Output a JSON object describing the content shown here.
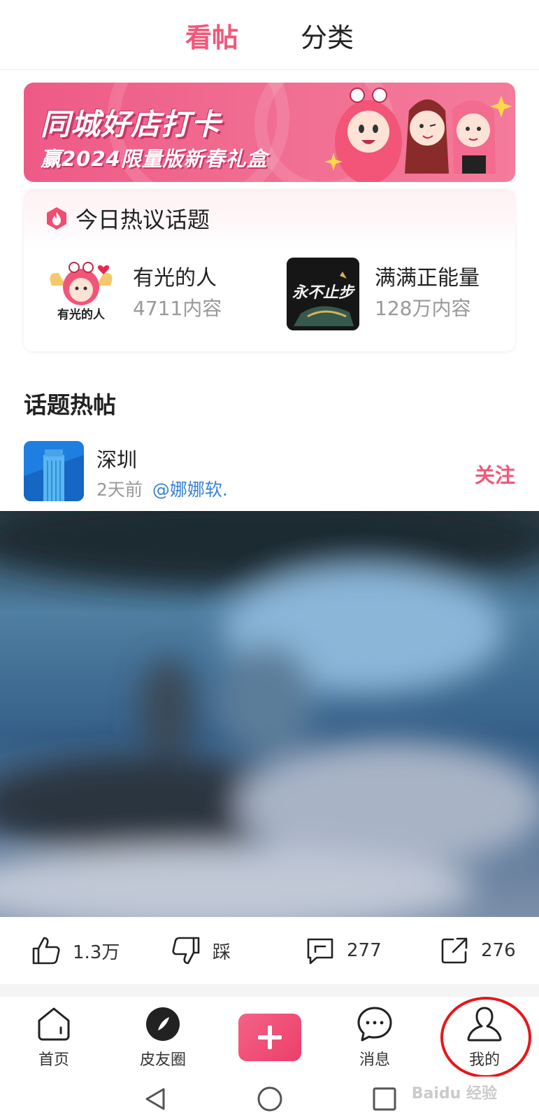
{
  "top_tabs": {
    "active": "看帖",
    "inactive": "分类"
  },
  "banner": {
    "title": "同城好店打卡",
    "subtitle": "赢2024限量版新春礼盒"
  },
  "hot_topics": {
    "title": "今日热议话题",
    "items": [
      {
        "thumb_text": "有光的人",
        "name": "有光的人",
        "count": "4711内容"
      },
      {
        "thumb_text": "永不止步",
        "name": "满满正能量",
        "count": "128万内容"
      }
    ]
  },
  "section_title": "话题热帖",
  "post": {
    "topic_name": "深圳",
    "time": "2天前",
    "author": "@娜娜软.",
    "follow_label": "关注",
    "likes": "1.3万",
    "dislike_label": "踩",
    "comments": "277",
    "shares": "276"
  },
  "bottom_nav": {
    "home": "首页",
    "circle": "皮友圈",
    "messages": "消息",
    "me": "我的"
  },
  "watermark": "Baidu 经验",
  "colors": {
    "accent": "#f0587a",
    "mention": "#3b82d6",
    "highlight": "#e8161d"
  }
}
